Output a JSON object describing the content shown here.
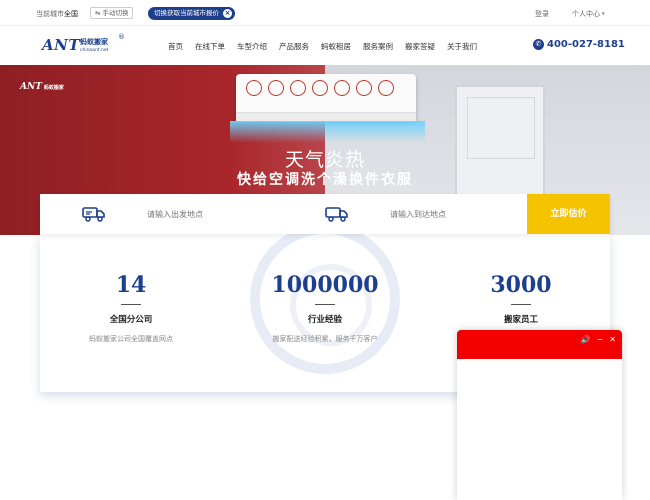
{
  "topbar": {
    "city_label": "当前城市：",
    "city_value": "全国",
    "switch_label": "手动切换",
    "locate_label": "切换获取当前城市报价",
    "login": "登录",
    "user_center": "个人中心"
  },
  "brand": {
    "logo_en": "ANT",
    "logo_cn": "蚂蚁搬家",
    "logo_url": "chinaant.net",
    "logo_reg": "®"
  },
  "nav": {
    "items": [
      "首页",
      "在线下单",
      "车型介绍",
      "产品服务",
      "蚂蚁租居",
      "服务案例",
      "搬家答疑",
      "关于我们"
    ],
    "phone": "400-027-8181"
  },
  "banner": {
    "logo": "ANT",
    "logo_small": "蚂蚁搬家",
    "title": "天气炎热",
    "subtitle": "快给空调洗个澡换件衣服"
  },
  "search": {
    "from_placeholder": "请输入出发地点",
    "to_placeholder": "请输入到达地点",
    "button": "立即估价"
  },
  "stats": [
    {
      "value": "14",
      "label": "全国分公司",
      "desc": "蚂蚁搬家公司全国覆盖网点"
    },
    {
      "value": "1000000",
      "label": "行业经验",
      "desc": "搬家配送经验积累，服务千万客户"
    },
    {
      "value": "3000",
      "label": "搬家员工",
      "desc": ""
    }
  ],
  "chat": {
    "sound_icon": "🔊",
    "minimize_icon": "−",
    "close_icon": "✕"
  },
  "colors": {
    "brand_blue": "#1d3f8e",
    "cta_yellow": "#f6c300",
    "chat_red": "#f20000"
  }
}
